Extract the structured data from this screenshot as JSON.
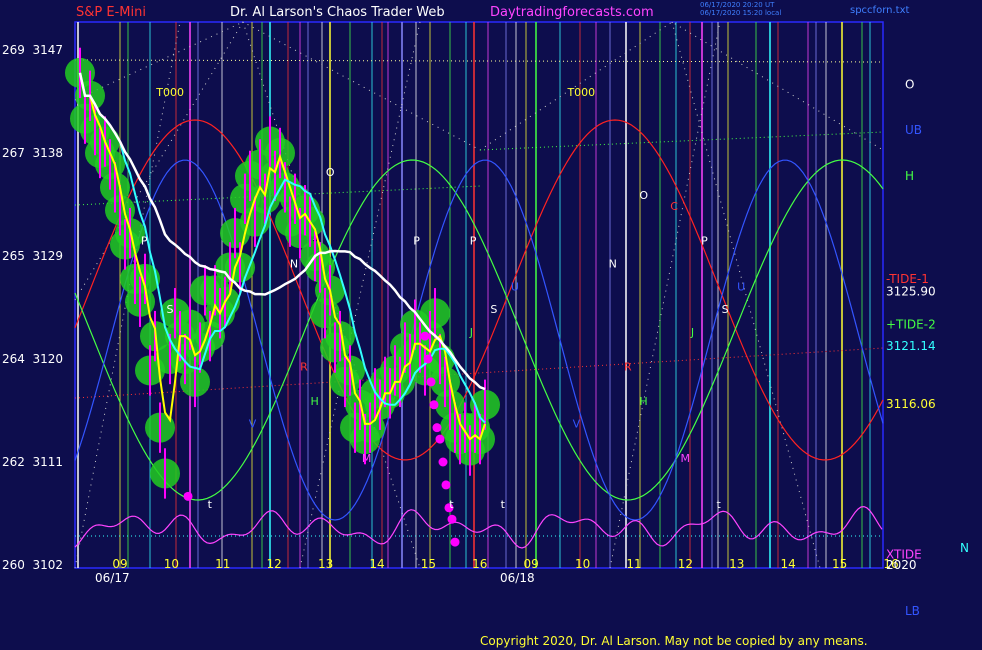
{
  "header": {
    "symbol": "S&P E-Mini",
    "title": "Dr. Al Larson's Chaos Trader Web",
    "site": "Daytradingforecasts.com",
    "update_line1": "06/17/2020 20:20 UT",
    "update_line2": "06/17/2020 15:20 local",
    "file": "spccforn.txt"
  },
  "footer": {
    "copyright": "Copyright 2020, Dr. Al Larson. May not be copied by any means."
  },
  "colors": {
    "background": "#0d0d4d",
    "frame": "#2a2aff",
    "price_bars": "#ff00ff",
    "glow": "#22cc22",
    "fast_ma": "#ffff00",
    "mid_ma": "#33ffff",
    "slow_ma": "#ffffff",
    "tide_up": "#44ff44",
    "tide_down": "#ff2222",
    "xtide": "#ff44ff",
    "forecast_dots": "#ff00ff",
    "label": "#ff3333"
  },
  "chart_data": {
    "type": "line",
    "title": "S&P E-Mini",
    "y_axis_right_labels": [
      "3147",
      "3138",
      "3129",
      "3120",
      "3111",
      "3102"
    ],
    "y_axis_left_labels": [
      "269",
      "267",
      "265",
      "264",
      "262",
      "260"
    ],
    "ylim": [
      3102,
      3147
    ],
    "x_tick_labels": [
      "09",
      "10",
      "11",
      "12",
      "13",
      "14",
      "15",
      "16",
      "09",
      "10",
      "11",
      "12",
      "13",
      "14",
      "15",
      "16"
    ],
    "dates": [
      "06/17",
      "06/18"
    ],
    "price_series": {
      "name": "S&P E-Mini",
      "x": [
        0,
        1,
        2,
        3,
        4,
        5,
        6,
        7,
        8,
        9,
        10,
        11,
        12,
        13,
        14,
        15,
        16,
        17,
        18,
        19,
        20,
        21,
        22,
        23,
        24,
        25,
        26,
        27,
        28,
        29,
        30,
        31,
        32,
        33,
        34,
        35,
        36,
        37,
        38,
        39,
        40,
        41,
        42,
        43,
        44,
        45,
        46,
        47,
        48,
        49,
        50,
        51,
        52,
        53,
        54,
        55,
        56,
        57,
        58,
        59,
        60,
        61,
        62,
        63,
        64,
        65,
        66,
        67,
        68,
        69,
        70,
        71,
        72,
        73,
        74,
        75,
        76,
        77,
        78,
        79,
        80,
        81
      ],
      "values": [
        3145,
        3141,
        3143,
        3140,
        3138,
        3139,
        3137,
        3135,
        3133,
        3130,
        3131,
        3127,
        3125,
        3127,
        3119,
        3122,
        3114,
        3110,
        3120,
        3124,
        3122,
        3120,
        3123,
        3118,
        3121,
        3126,
        3122,
        3126,
        3124,
        3125,
        3128,
        3131,
        3128,
        3134,
        3136,
        3132,
        3137,
        3134,
        3139,
        3136,
        3138,
        3135,
        3132,
        3134,
        3131,
        3133,
        3132,
        3129,
        3128,
        3124,
        3126,
        3121,
        3122,
        3118,
        3119,
        3114,
        3116,
        3113,
        3114,
        3117,
        3116,
        3118,
        3117,
        3119,
        3118,
        3121,
        3120,
        3123,
        3121,
        3119,
        3122,
        3124,
        3120,
        3118,
        3116,
        3114,
        3113,
        3114,
        3112,
        3114,
        3113,
        3116
      ]
    },
    "forecast_dots": [
      3122,
      3120,
      3118,
      3116,
      3114,
      3113,
      3111,
      3109,
      3107,
      3106,
      3104
    ],
    "right_labels": [
      {
        "text": "O",
        "color": "#ffffff",
        "value": 3144
      },
      {
        "text": "UB",
        "color": "#3355ff",
        "value": 3140
      },
      {
        "text": "H",
        "color": "#44ff44",
        "value": 3136
      },
      {
        "text": "-TIDE-1",
        "color": "#ff3333",
        "value": 3127
      },
      {
        "text": "3125.90",
        "color": "#ffffff",
        "value": 3125.9
      },
      {
        "text": "+TIDE-2",
        "color": "#44ff44",
        "value": 3123
      },
      {
        "text": "3121.14",
        "color": "#33ffff",
        "value": 3121.14
      },
      {
        "text": "3116.06",
        "color": "#ffff33",
        "value": 3116.06
      },
      {
        "text": "N",
        "color": "#33ffff",
        "value": 3103.5
      },
      {
        "text": "XTIDE",
        "color": "#ff44ff",
        "value": 3102.9
      },
      {
        "text": "2020",
        "color": "#ffffff",
        "value": 3102
      },
      {
        "text": "LB",
        "color": "#3355ff",
        "value": 3098
      }
    ],
    "chart_marks": [
      {
        "text": "T000",
        "color": "#ffff33",
        "x": 0.9,
        "value": 3143
      },
      {
        "text": "T000",
        "color": "#ffff33",
        "x": 8.9,
        "value": 3143
      },
      {
        "text": "P",
        "color": "#ffffff",
        "x": 0.6,
        "value": 3130
      },
      {
        "text": "S",
        "color": "#ffffff",
        "x": 1.1,
        "value": 3124
      },
      {
        "text": "O",
        "color": "#ffffff",
        "x": 4.2,
        "value": 3136
      },
      {
        "text": "N",
        "color": "#ffffff",
        "x": 3.5,
        "value": 3128
      },
      {
        "text": "P",
        "color": "#ffffff",
        "x": 5.9,
        "value": 3130
      },
      {
        "text": "P",
        "color": "#ffffff",
        "x": 7.0,
        "value": 3130
      },
      {
        "text": "S",
        "color": "#ffffff",
        "x": 7.4,
        "value": 3124
      },
      {
        "text": "N",
        "color": "#ffffff",
        "x": 9.7,
        "value": 3128
      },
      {
        "text": "O",
        "color": "#ffffff",
        "x": 10.3,
        "value": 3134
      },
      {
        "text": "P",
        "color": "#ffffff",
        "x": 11.5,
        "value": 3130
      },
      {
        "text": "S",
        "color": "#ffffff",
        "x": 11.9,
        "value": 3124
      },
      {
        "text": "R",
        "color": "#ff3333",
        "x": 3.7,
        "value": 3119
      },
      {
        "text": "R",
        "color": "#ff3333",
        "x": 10.0,
        "value": 3119
      },
      {
        "text": "C",
        "color": "#ff3333",
        "x": 10.9,
        "value": 3133
      },
      {
        "text": "H",
        "color": "#44ff44",
        "x": 3.9,
        "value": 3116
      },
      {
        "text": "H",
        "color": "#44ff44",
        "x": 10.3,
        "value": 3116
      },
      {
        "text": "J",
        "color": "#44ff44",
        "x": 7.0,
        "value": 3122
      },
      {
        "text": "J",
        "color": "#44ff44",
        "x": 11.3,
        "value": 3122
      },
      {
        "text": "U",
        "color": "#3355ff",
        "x": 7.8,
        "value": 3126
      },
      {
        "text": "U",
        "color": "#3355ff",
        "x": 12.2,
        "value": 3126
      },
      {
        "text": "V",
        "color": "#3355ff",
        "x": 2.7,
        "value": 3114
      },
      {
        "text": "V",
        "color": "#3355ff",
        "x": 9.0,
        "value": 3114
      },
      {
        "text": "M",
        "color": "#ff44ff",
        "x": 4.9,
        "value": 3111
      },
      {
        "text": "M",
        "color": "#ff44ff",
        "x": 11.1,
        "value": 3111
      },
      {
        "text": "t",
        "color": "#ffffff",
        "x": 1.9,
        "value": 3107
      },
      {
        "text": "t",
        "color": "#ffffff",
        "x": 6.6,
        "value": 3107
      },
      {
        "text": "t",
        "color": "#ffffff",
        "x": 7.6,
        "value": 3107
      },
      {
        "text": "t",
        "color": "#ffffff",
        "x": 11.8,
        "value": 3107
      }
    ],
    "grid": false,
    "legend": "right"
  }
}
